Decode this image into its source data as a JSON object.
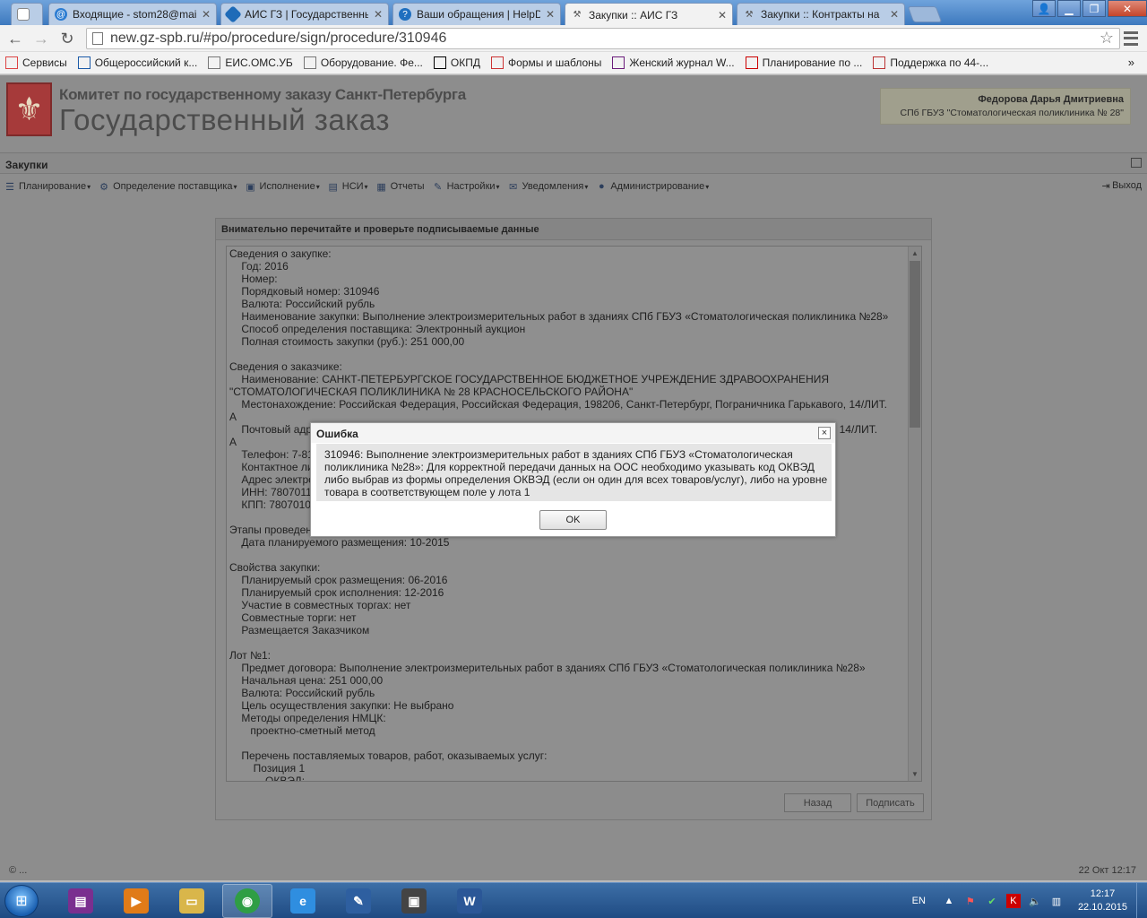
{
  "browser": {
    "tabs": [
      {
        "label": "",
        "icon": "blank-page-icon"
      },
      {
        "label": "Входящие - stom28@mai",
        "icon": "mail-icon"
      },
      {
        "label": "АИС ГЗ | Государственны",
        "icon": "ais-icon"
      },
      {
        "label": "Ваши обращения | HelpD",
        "icon": "helpdesk-icon"
      },
      {
        "label": "Закупки :: АИС ГЗ",
        "icon": "gavel-icon"
      },
      {
        "label": "Закупки :: Контракты на",
        "icon": "gavel-icon"
      }
    ],
    "url": "new.gz-spb.ru/#po/procedure/sign/procedure/310946",
    "bookmarks": [
      {
        "label": "Сервисы",
        "icon": "apps-icon",
        "color": "#d44"
      },
      {
        "label": "Общероссийский к...",
        "icon": "p3-icon",
        "color": "#1b5aa8"
      },
      {
        "label": "ЕИС.ОМС.УБ",
        "icon": "page-icon",
        "color": "#777"
      },
      {
        "label": "Оборудование. Фе...",
        "icon": "page-icon",
        "color": "#777"
      },
      {
        "label": "ОКПД",
        "icon": "ru-icon",
        "color": "#000"
      },
      {
        "label": "Формы и шаблоны",
        "icon": "target-icon",
        "color": "#c33"
      },
      {
        "label": "Женский журнал W...",
        "icon": "w-icon",
        "color": "#6a1b7a"
      },
      {
        "label": "Планирование по ...",
        "icon": "rts-icon",
        "color": "#c00"
      },
      {
        "label": "Поддержка по 44-...",
        "icon": "support-icon",
        "color": "#b33"
      }
    ],
    "bookmarks_more": "»"
  },
  "header": {
    "org_small": "Комитет по государственному заказу Санкт-Петербурга",
    "org_big": "Государственный заказ",
    "user_name": "Федорова Дарья Дмитриевна",
    "user_org": "СПб ГБУЗ \"Стоматологическая поликлиника № 28\""
  },
  "section_title": "Закупки",
  "menu": [
    {
      "label": "Планирование",
      "icon": "planning-icon",
      "caret": true
    },
    {
      "label": "Определение поставщика",
      "icon": "supplier-icon",
      "caret": true
    },
    {
      "label": "Исполнение",
      "icon": "execution-icon",
      "caret": true
    },
    {
      "label": "НСИ",
      "icon": "book-icon",
      "caret": true
    },
    {
      "label": "Отчеты",
      "icon": "report-icon",
      "caret": false
    },
    {
      "label": "Настройки",
      "icon": "wrench-icon",
      "caret": true
    },
    {
      "label": "Уведомления",
      "icon": "envelope-icon",
      "caret": true
    },
    {
      "label": "Администрирование",
      "icon": "admin-icon",
      "caret": true
    }
  ],
  "exit_label": "Выход",
  "panel": {
    "title": "Внимательно перечитайте и проверьте подписываемые данные",
    "lines": [
      "Сведения о закупке:",
      "    Год: 2016",
      "    Номер:",
      "    Порядковый номер: 310946",
      "    Валюта: Российский рубль",
      "    Наименование закупки: Выполнение электроизмерительных работ в зданиях СПб ГБУЗ «Стоматологическая поликлиника №28»",
      "    Способ определения поставщика: Электронный аукцион",
      "    Полная стоимость закупки (руб.): 251 000,00",
      "",
      "Сведения о заказчике:",
      "    Наименование: САНКТ-ПЕТЕРБУРГСКОЕ ГОСУДАРСТВЕННОЕ БЮДЖЕТНОЕ УЧРЕЖДЕНИЕ ЗДРАВООХРАНЕНИЯ",
      "\"СТОМАТОЛОГИЧЕСКАЯ ПОЛИКЛИНИКА № 28 КРАСНОСЕЛЬСКОГО РАЙОНА\"",
      "    Местонахождение: Российская Федерация, Российская Федерация, 198206, Санкт-Петербург, Пограничника Гарькавого, 14/ЛИТ.",
      "А",
      "    Почтовый адрес: Российская Федерация, Российская Федерация, 198206, Санкт-Петербург, Пограничника Гарькавого, 14/ЛИТ.",
      "А",
      "    Телефон: 7-812-7356700",
      "    Контактное лицо: Федорова Дарья Дмитриевна",
      "    Адрес электронной почты: stom28@mail.ru",
      "    ИНН: 7807011409",
      "    КПП: 780701001",
      "",
      "Этапы проведения:",
      "    Дата планируемого размещения: 10-2015",
      "",
      "Свойства закупки:",
      "    Планируемый срок размещения: 06-2016",
      "    Планируемый срок исполнения: 12-2016",
      "    Участие в совместных торгах: нет",
      "    Совместные торги: нет",
      "    Размещается Заказчиком",
      "",
      "Лот №1:",
      "    Предмет договора: Выполнение электроизмерительных работ в зданиях СПб ГБУЗ «Стоматологическая поликлиника №28»",
      "    Начальная цена: 251 000,00",
      "    Валюта: Российский рубль",
      "    Цель осуществления закупки: Не выбрано",
      "    Методы определения НМЦК:",
      "       проектно-сметный метод",
      "",
      "    Перечень поставляемых товаров, работ, оказываемых услуг:",
      "        Позиция 1",
      "            ОКВЭД:"
    ],
    "back_label": "Назад",
    "sign_label": "Подписать"
  },
  "footer": {
    "copyright": "© ...",
    "timestamp": "22 Окт 12:17"
  },
  "modal": {
    "title": "Ошибка",
    "message": "310946: Выполнение электроизмерительных работ в зданиях СПб ГБУЗ «Стоматологическая поликлиника №28»: Для корректной передачи данных на ООС необходимо указывать код ОКВЭД либо выбрав из формы определения ОКВЭД (если он один для всех товаров/услуг), либо на уровне товара в соответствующем поле у лота 1",
    "ok_label": "OK",
    "close_label": "×"
  },
  "taskbar": {
    "apps": [
      {
        "name": "winrar",
        "icon": "winrar-icon",
        "color": "#7a2f8f"
      },
      {
        "name": "media-player",
        "icon": "media-player-icon",
        "color": "#e07b18"
      },
      {
        "name": "explorer",
        "icon": "folder-icon",
        "color": "#d9b64a"
      },
      {
        "name": "chrome",
        "icon": "chrome-icon",
        "color": "#2f9e44"
      },
      {
        "name": "ie",
        "icon": "ie-icon",
        "color": "#2f8ee0"
      },
      {
        "name": "crypto",
        "icon": "pen-icon",
        "color": "#2e5fa0"
      },
      {
        "name": "movie",
        "icon": "film-icon",
        "color": "#444"
      },
      {
        "name": "word",
        "icon": "word-icon",
        "color": "#2b5797"
      }
    ],
    "lang": "EN",
    "time": "12:17",
    "date": "22.10.2015"
  }
}
